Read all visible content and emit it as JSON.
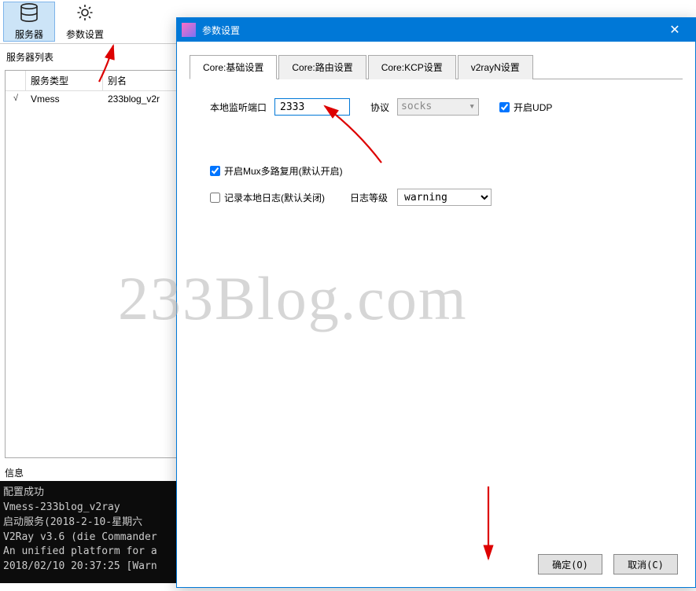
{
  "toolbar": {
    "servers_label": "服务器",
    "settings_label": "参数设置"
  },
  "server_list": {
    "title": "服务器列表",
    "columns": {
      "type": "服务类型",
      "alias": "别名"
    },
    "rows": [
      {
        "checked": "√",
        "type": "Vmess",
        "alias": "233blog_v2r"
      }
    ]
  },
  "info_label": "信息",
  "console_lines": [
    "配置成功",
    "Vmess-233blog_v2ray",
    "启动服务(2018-2-10-星期六",
    "V2Ray v3.6 (die Commander",
    "An unified platform for a",
    "2018/02/10 20:37:25 [Warn"
  ],
  "dialog": {
    "title": "参数设置",
    "tabs": [
      "Core:基础设置",
      "Core:路由设置",
      "Core:KCP设置",
      "v2rayN设置"
    ],
    "active_tab": 0,
    "form": {
      "port_label": "本地监听端口",
      "port_value": "2333",
      "proto_label": "协议",
      "proto_value": "socks",
      "udp_label": "开启UDP",
      "udp_checked": true,
      "mux_label": "开启Mux多路复用(默认开启)",
      "mux_checked": true,
      "log_chk_label": "记录本地日志(默认关闭)",
      "log_chk_checked": false,
      "log_level_label": "日志等级",
      "log_level_value": "warning"
    },
    "buttons": {
      "ok": "确定(O)",
      "cancel": "取消(C)"
    }
  },
  "watermark": "233Blog.com"
}
